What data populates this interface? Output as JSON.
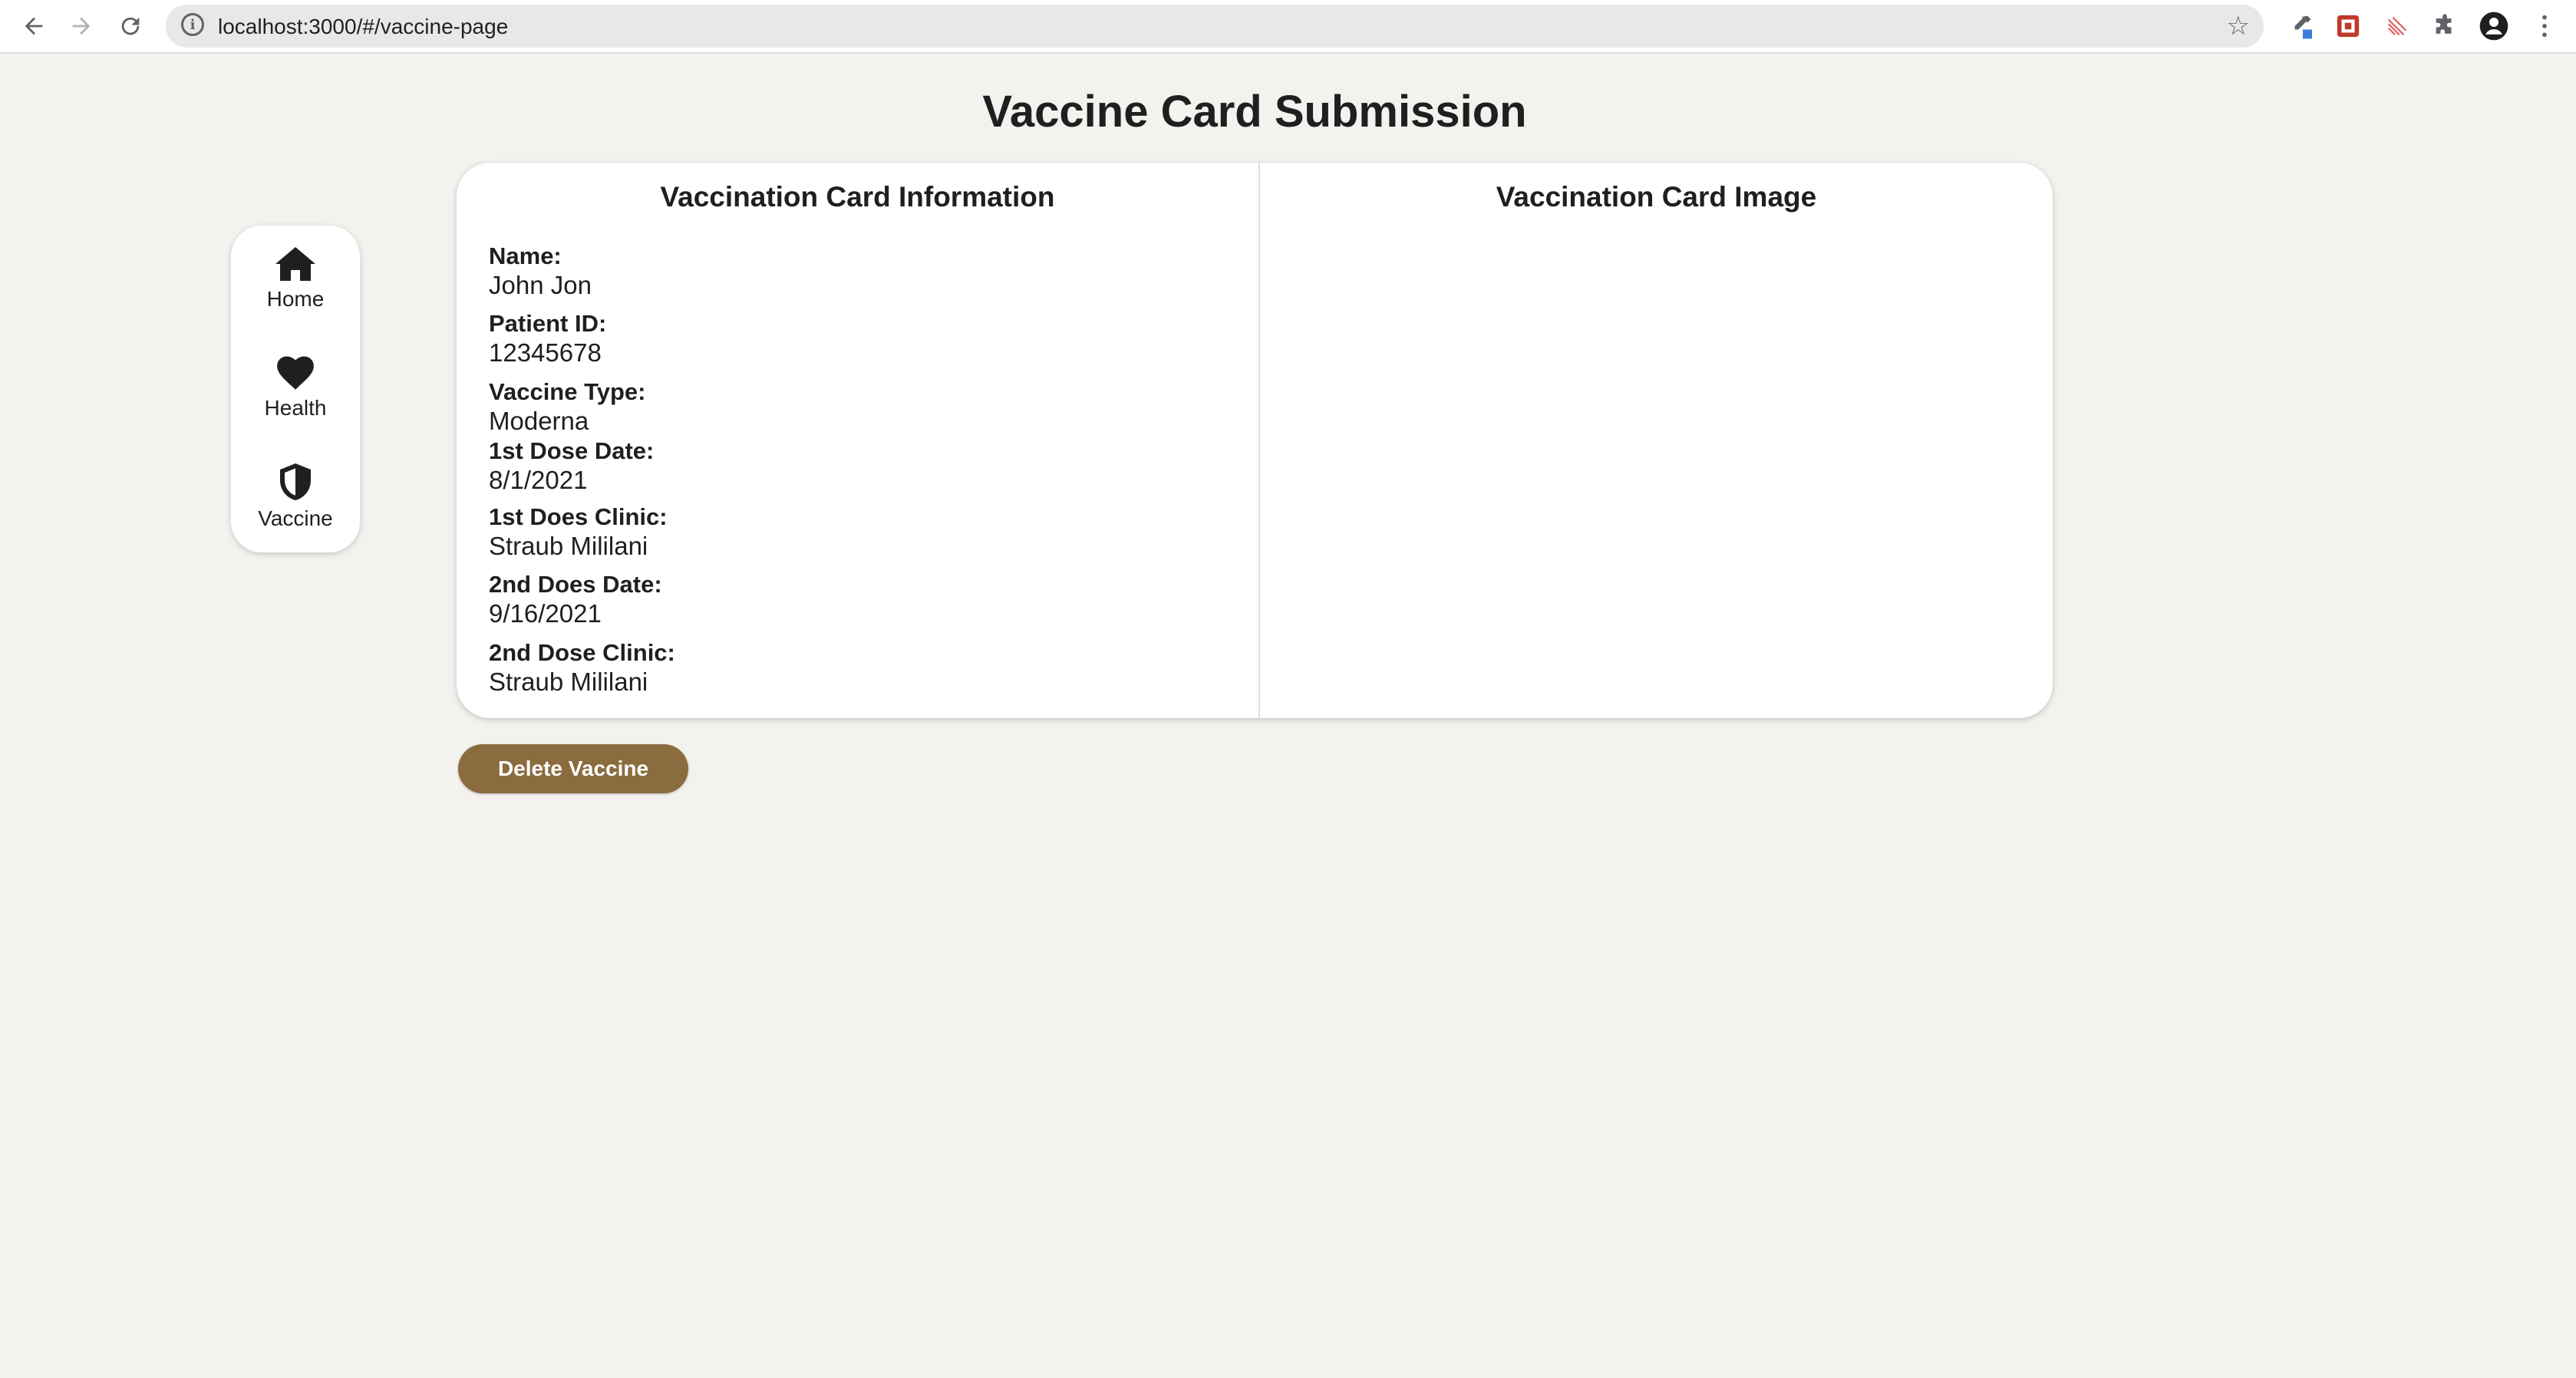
{
  "browser": {
    "url": "localhost:3000/#/vaccine-page"
  },
  "page": {
    "title": "Vaccine Card Submission"
  },
  "sidenav": {
    "items": [
      {
        "label": "Home",
        "icon": "home-icon"
      },
      {
        "label": "Health",
        "icon": "heart-icon"
      },
      {
        "label": "Vaccine",
        "icon": "shield-icon"
      }
    ]
  },
  "card": {
    "info_heading": "Vaccination Card Information",
    "image_heading": "Vaccination Card Image",
    "fields": [
      {
        "label": "Name:",
        "value": "John Jon"
      },
      {
        "label": "Patient ID:",
        "value": "12345678"
      },
      {
        "label": "Vaccine Type:",
        "value": "Moderna"
      },
      {
        "label": "1st Dose Date:",
        "value": "8/1/2021"
      },
      {
        "label": "1st Does Clinic:",
        "value": "Straub Mililani"
      },
      {
        "label": "2nd Does Date:",
        "value": "9/16/2021"
      },
      {
        "label": "2nd Dose Clinic:",
        "value": "Straub Mililani"
      }
    ]
  },
  "actions": {
    "delete_label": "Delete Vaccine"
  },
  "colors": {
    "accent": "#8b6c3e",
    "background": "#f3f2ee"
  }
}
